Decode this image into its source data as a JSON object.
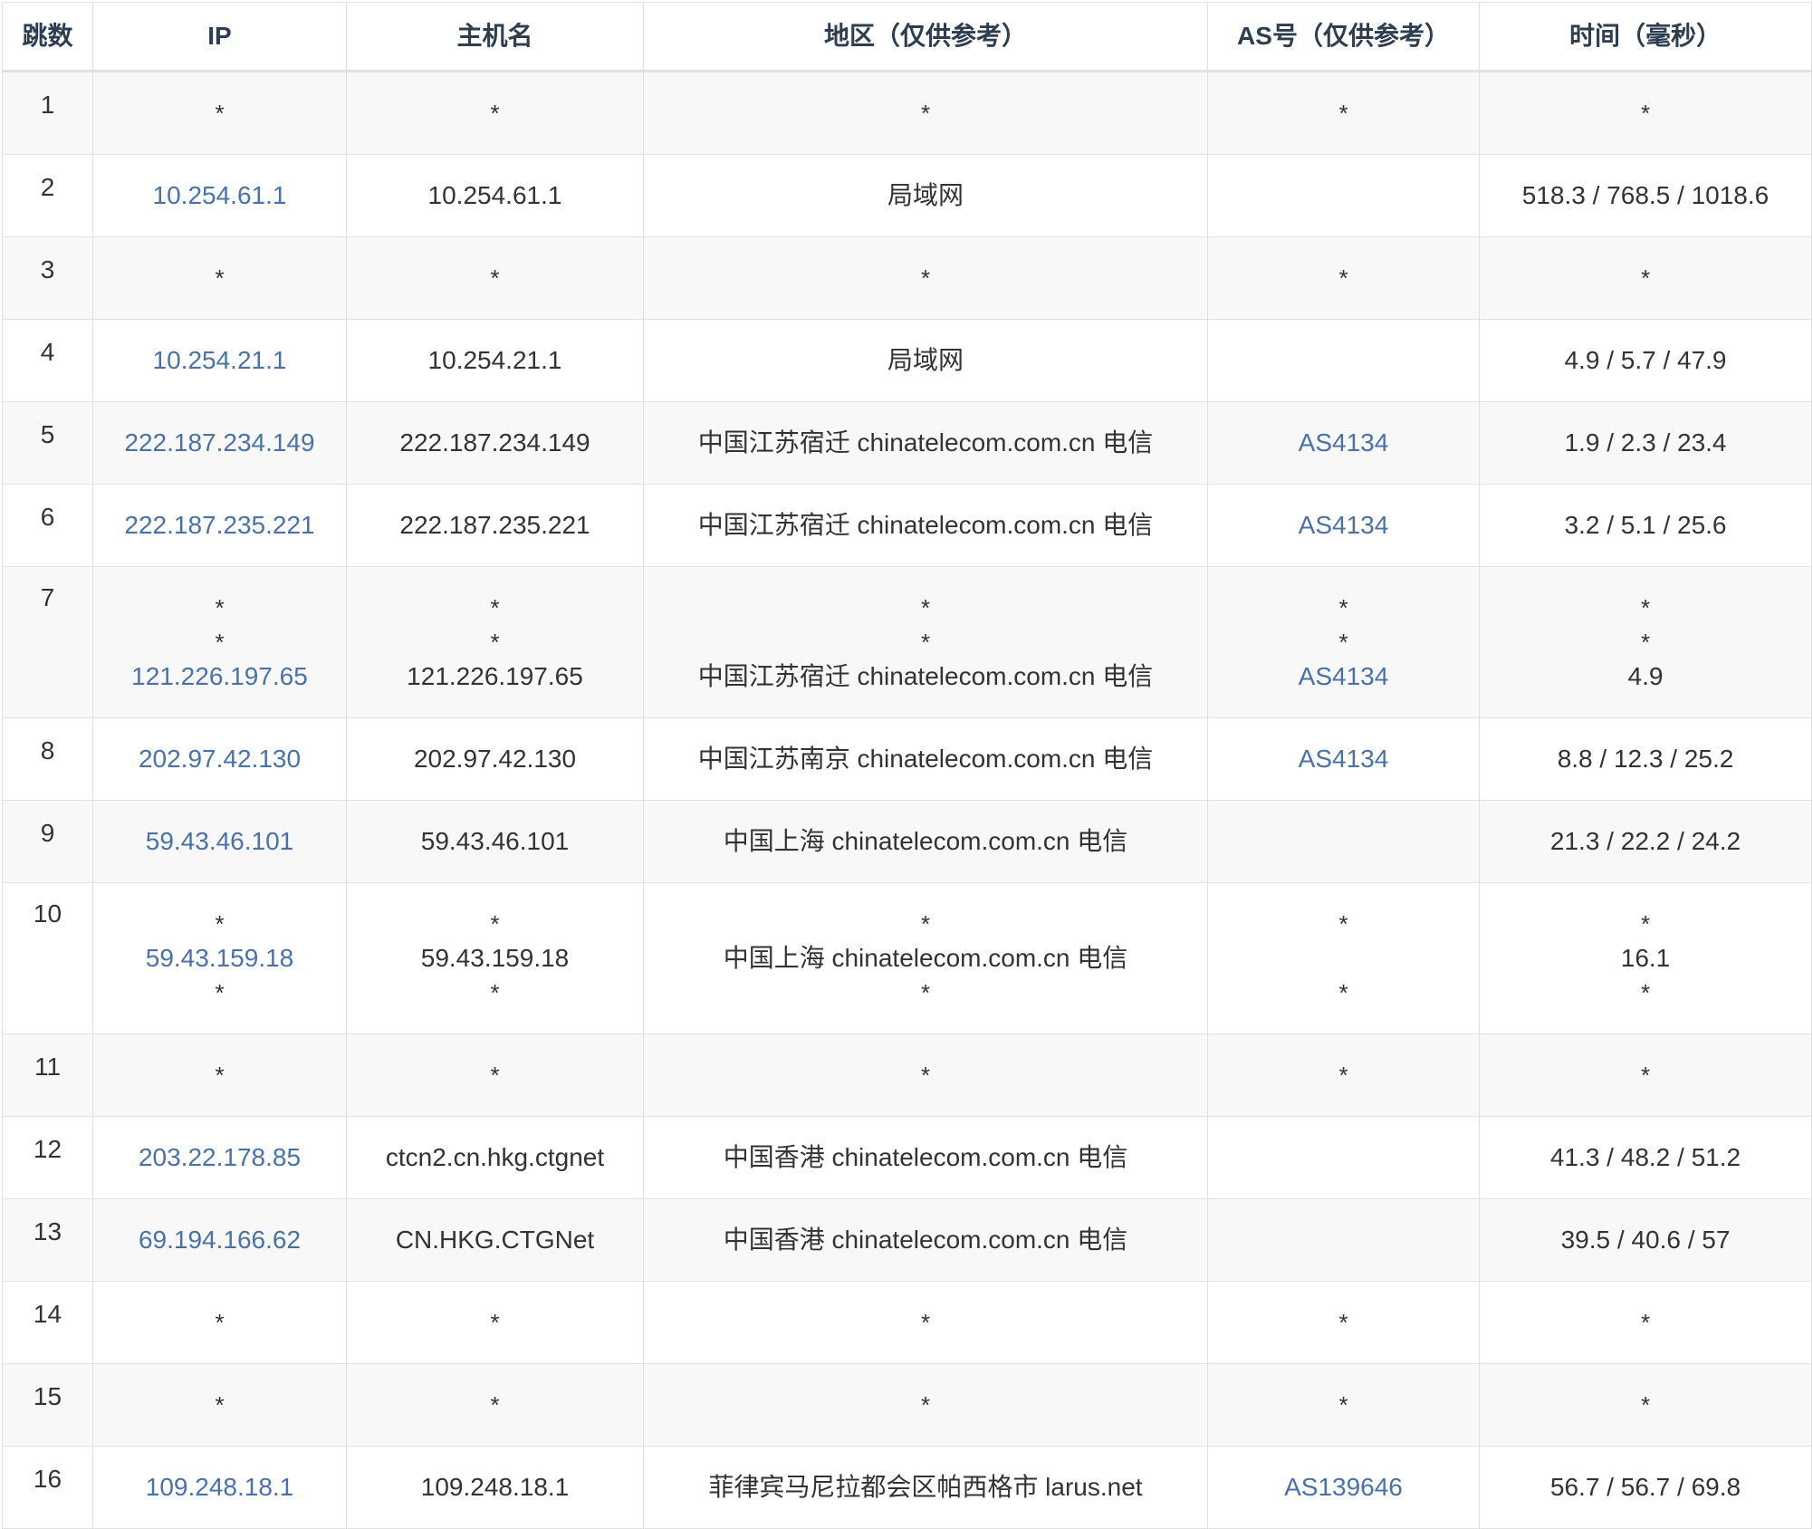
{
  "columns": [
    "跳数",
    "IP",
    "主机名",
    "地区（仅供参考）",
    "AS号（仅供参考）",
    "时间（毫秒）"
  ],
  "rows": [
    {
      "hop": "1",
      "ip": "*",
      "host": "*",
      "region": "*",
      "asn": "*",
      "time": "*"
    },
    {
      "hop": "2",
      "ip": "10.254.61.1",
      "host": "10.254.61.1",
      "region": "局域网",
      "asn": "",
      "time": "518.3 / 768.5 / 1018.6"
    },
    {
      "hop": "3",
      "ip": "*",
      "host": "*",
      "region": "*",
      "asn": "*",
      "time": "*"
    },
    {
      "hop": "4",
      "ip": "10.254.21.1",
      "host": "10.254.21.1",
      "region": "局域网",
      "asn": "",
      "time": "4.9 / 5.7 / 47.9"
    },
    {
      "hop": "5",
      "ip": "222.187.234.149",
      "host": "222.187.234.149",
      "region": "中国江苏宿迁 chinatelecom.com.cn 电信",
      "asn": "AS4134",
      "time": "1.9 / 2.3 / 23.4"
    },
    {
      "hop": "6",
      "ip": "222.187.235.221",
      "host": "222.187.235.221",
      "region": "中国江苏宿迁 chinatelecom.com.cn 电信",
      "asn": "AS4134",
      "time": "3.2 / 5.1 / 25.6"
    },
    {
      "hop": "7",
      "ip": [
        "*",
        "*",
        "121.226.197.65"
      ],
      "host": [
        "*",
        "*",
        "121.226.197.65"
      ],
      "region": [
        "*",
        "*",
        "中国江苏宿迁 chinatelecom.com.cn 电信"
      ],
      "asn": [
        "*",
        "*",
        "AS4134"
      ],
      "time": [
        "*",
        "*",
        "4.9"
      ]
    },
    {
      "hop": "8",
      "ip": "202.97.42.130",
      "host": "202.97.42.130",
      "region": "中国江苏南京 chinatelecom.com.cn 电信",
      "asn": "AS4134",
      "time": "8.8 / 12.3 / 25.2"
    },
    {
      "hop": "9",
      "ip": "59.43.46.101",
      "host": "59.43.46.101",
      "region": "中国上海 chinatelecom.com.cn 电信",
      "asn": "",
      "time": "21.3 / 22.2 / 24.2"
    },
    {
      "hop": "10",
      "ip": [
        "*",
        "59.43.159.18",
        "*"
      ],
      "host": [
        "*",
        "59.43.159.18",
        "*"
      ],
      "region": [
        "*",
        "中国上海 chinatelecom.com.cn 电信",
        "*"
      ],
      "asn": [
        "*",
        "",
        "*"
      ],
      "time": [
        "*",
        "16.1",
        "*"
      ]
    },
    {
      "hop": "11",
      "ip": "*",
      "host": "*",
      "region": "*",
      "asn": "*",
      "time": "*"
    },
    {
      "hop": "12",
      "ip": "203.22.178.85",
      "host": "ctcn2.cn.hkg.ctgnet",
      "region": "中国香港 chinatelecom.com.cn 电信",
      "asn": "",
      "time": "41.3 / 48.2 / 51.2"
    },
    {
      "hop": "13",
      "ip": "69.194.166.62",
      "host": "CN.HKG.CTGNet",
      "region": "中国香港 chinatelecom.com.cn 电信",
      "asn": "",
      "time": "39.5 / 40.6 / 57"
    },
    {
      "hop": "14",
      "ip": "*",
      "host": "*",
      "region": "*",
      "asn": "*",
      "time": "*"
    },
    {
      "hop": "15",
      "ip": "*",
      "host": "*",
      "region": "*",
      "asn": "*",
      "time": "*"
    },
    {
      "hop": "16",
      "ip": "109.248.18.1",
      "host": "109.248.18.1",
      "region": "菲律宾马尼拉都会区帕西格市 larus.net",
      "asn": "AS139646",
      "time": "56.7 / 56.7 / 69.8"
    }
  ]
}
